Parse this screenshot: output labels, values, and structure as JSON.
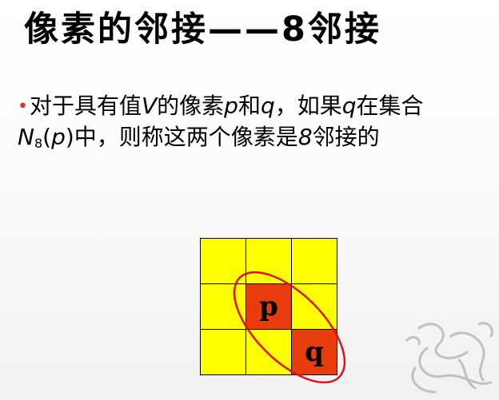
{
  "slide": {
    "title": "像素的邻接——8邻接",
    "bullet_symbol": "•",
    "line1_a": "对于具有值",
    "line1_v": "V",
    "line1_b": "的像素",
    "line1_p": "p",
    "line1_c": "和",
    "line1_q": "q",
    "line1_d": "，如果",
    "line1_q2": "q",
    "line1_e": "在集合",
    "line2_n": "N",
    "line2_sub": "8",
    "line2_paren_open": "(",
    "line2_p": "p",
    "line2_paren_close": ")",
    "line2_a": "中，则称这两个像素是",
    "line2_8": "8",
    "line2_b": "邻接的"
  },
  "grid": {
    "cells": [
      "",
      "",
      "",
      "",
      "p",
      "",
      "",
      "",
      "q"
    ],
    "red_cells": [
      4,
      8
    ],
    "colors": {
      "yellow": "#ffff00",
      "red": "#e83c0c",
      "ellipse": "#e01010"
    }
  }
}
